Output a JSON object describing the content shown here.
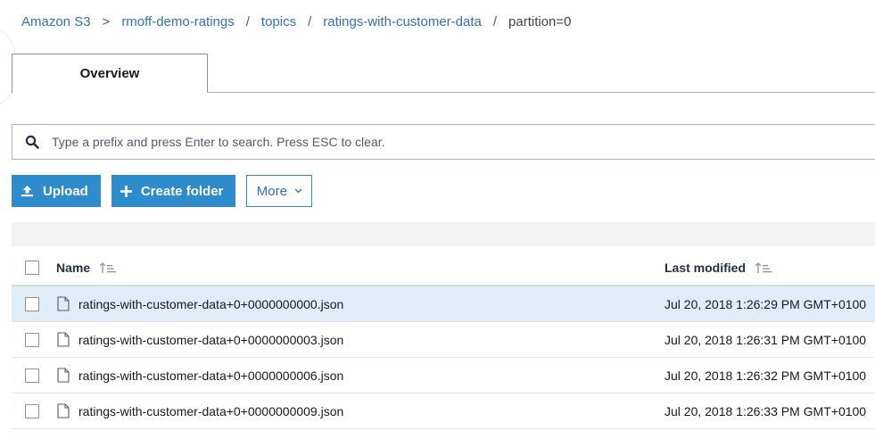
{
  "breadcrumb": {
    "items": [
      "Amazon S3",
      "rmoff-demo-ratings",
      "topics",
      "ratings-with-customer-data"
    ],
    "current": "partition=0",
    "separator": "/",
    "first_separator": ">"
  },
  "tabs": [
    {
      "label": "Overview",
      "active": true
    }
  ],
  "search": {
    "placeholder": "Type a prefix and press Enter to search. Press ESC to clear.",
    "value": "",
    "icon": "search-icon"
  },
  "toolbar": {
    "upload_label": "Upload",
    "upload_icon": "upload-icon",
    "create_folder_label": "Create folder",
    "create_folder_icon": "plus-icon",
    "more_label": "More",
    "more_icon": "chevron-down-icon"
  },
  "table": {
    "columns": [
      "Name",
      "Last modified"
    ],
    "sort_icon": "sort-ascending-icon",
    "rows": [
      {
        "name": "ratings-with-customer-data+0+0000000000.json",
        "modified": "Jul 20, 2018 1:26:29 PM GMT+0100",
        "selected": true,
        "icon": "file-icon"
      },
      {
        "name": "ratings-with-customer-data+0+0000000003.json",
        "modified": "Jul 20, 2018 1:26:31 PM GMT+0100",
        "selected": false,
        "icon": "file-icon"
      },
      {
        "name": "ratings-with-customer-data+0+0000000006.json",
        "modified": "Jul 20, 2018 1:26:32 PM GMT+0100",
        "selected": false,
        "icon": "file-icon"
      },
      {
        "name": "ratings-with-customer-data+0+0000000009.json",
        "modified": "Jul 20, 2018 1:26:33 PM GMT+0100",
        "selected": false,
        "icon": "file-icon"
      }
    ]
  },
  "colors": {
    "link": "#2e73b8",
    "primary_button": "#2e8bcc",
    "selected_row": "#e1edf6",
    "band": "#f2f3f3"
  }
}
